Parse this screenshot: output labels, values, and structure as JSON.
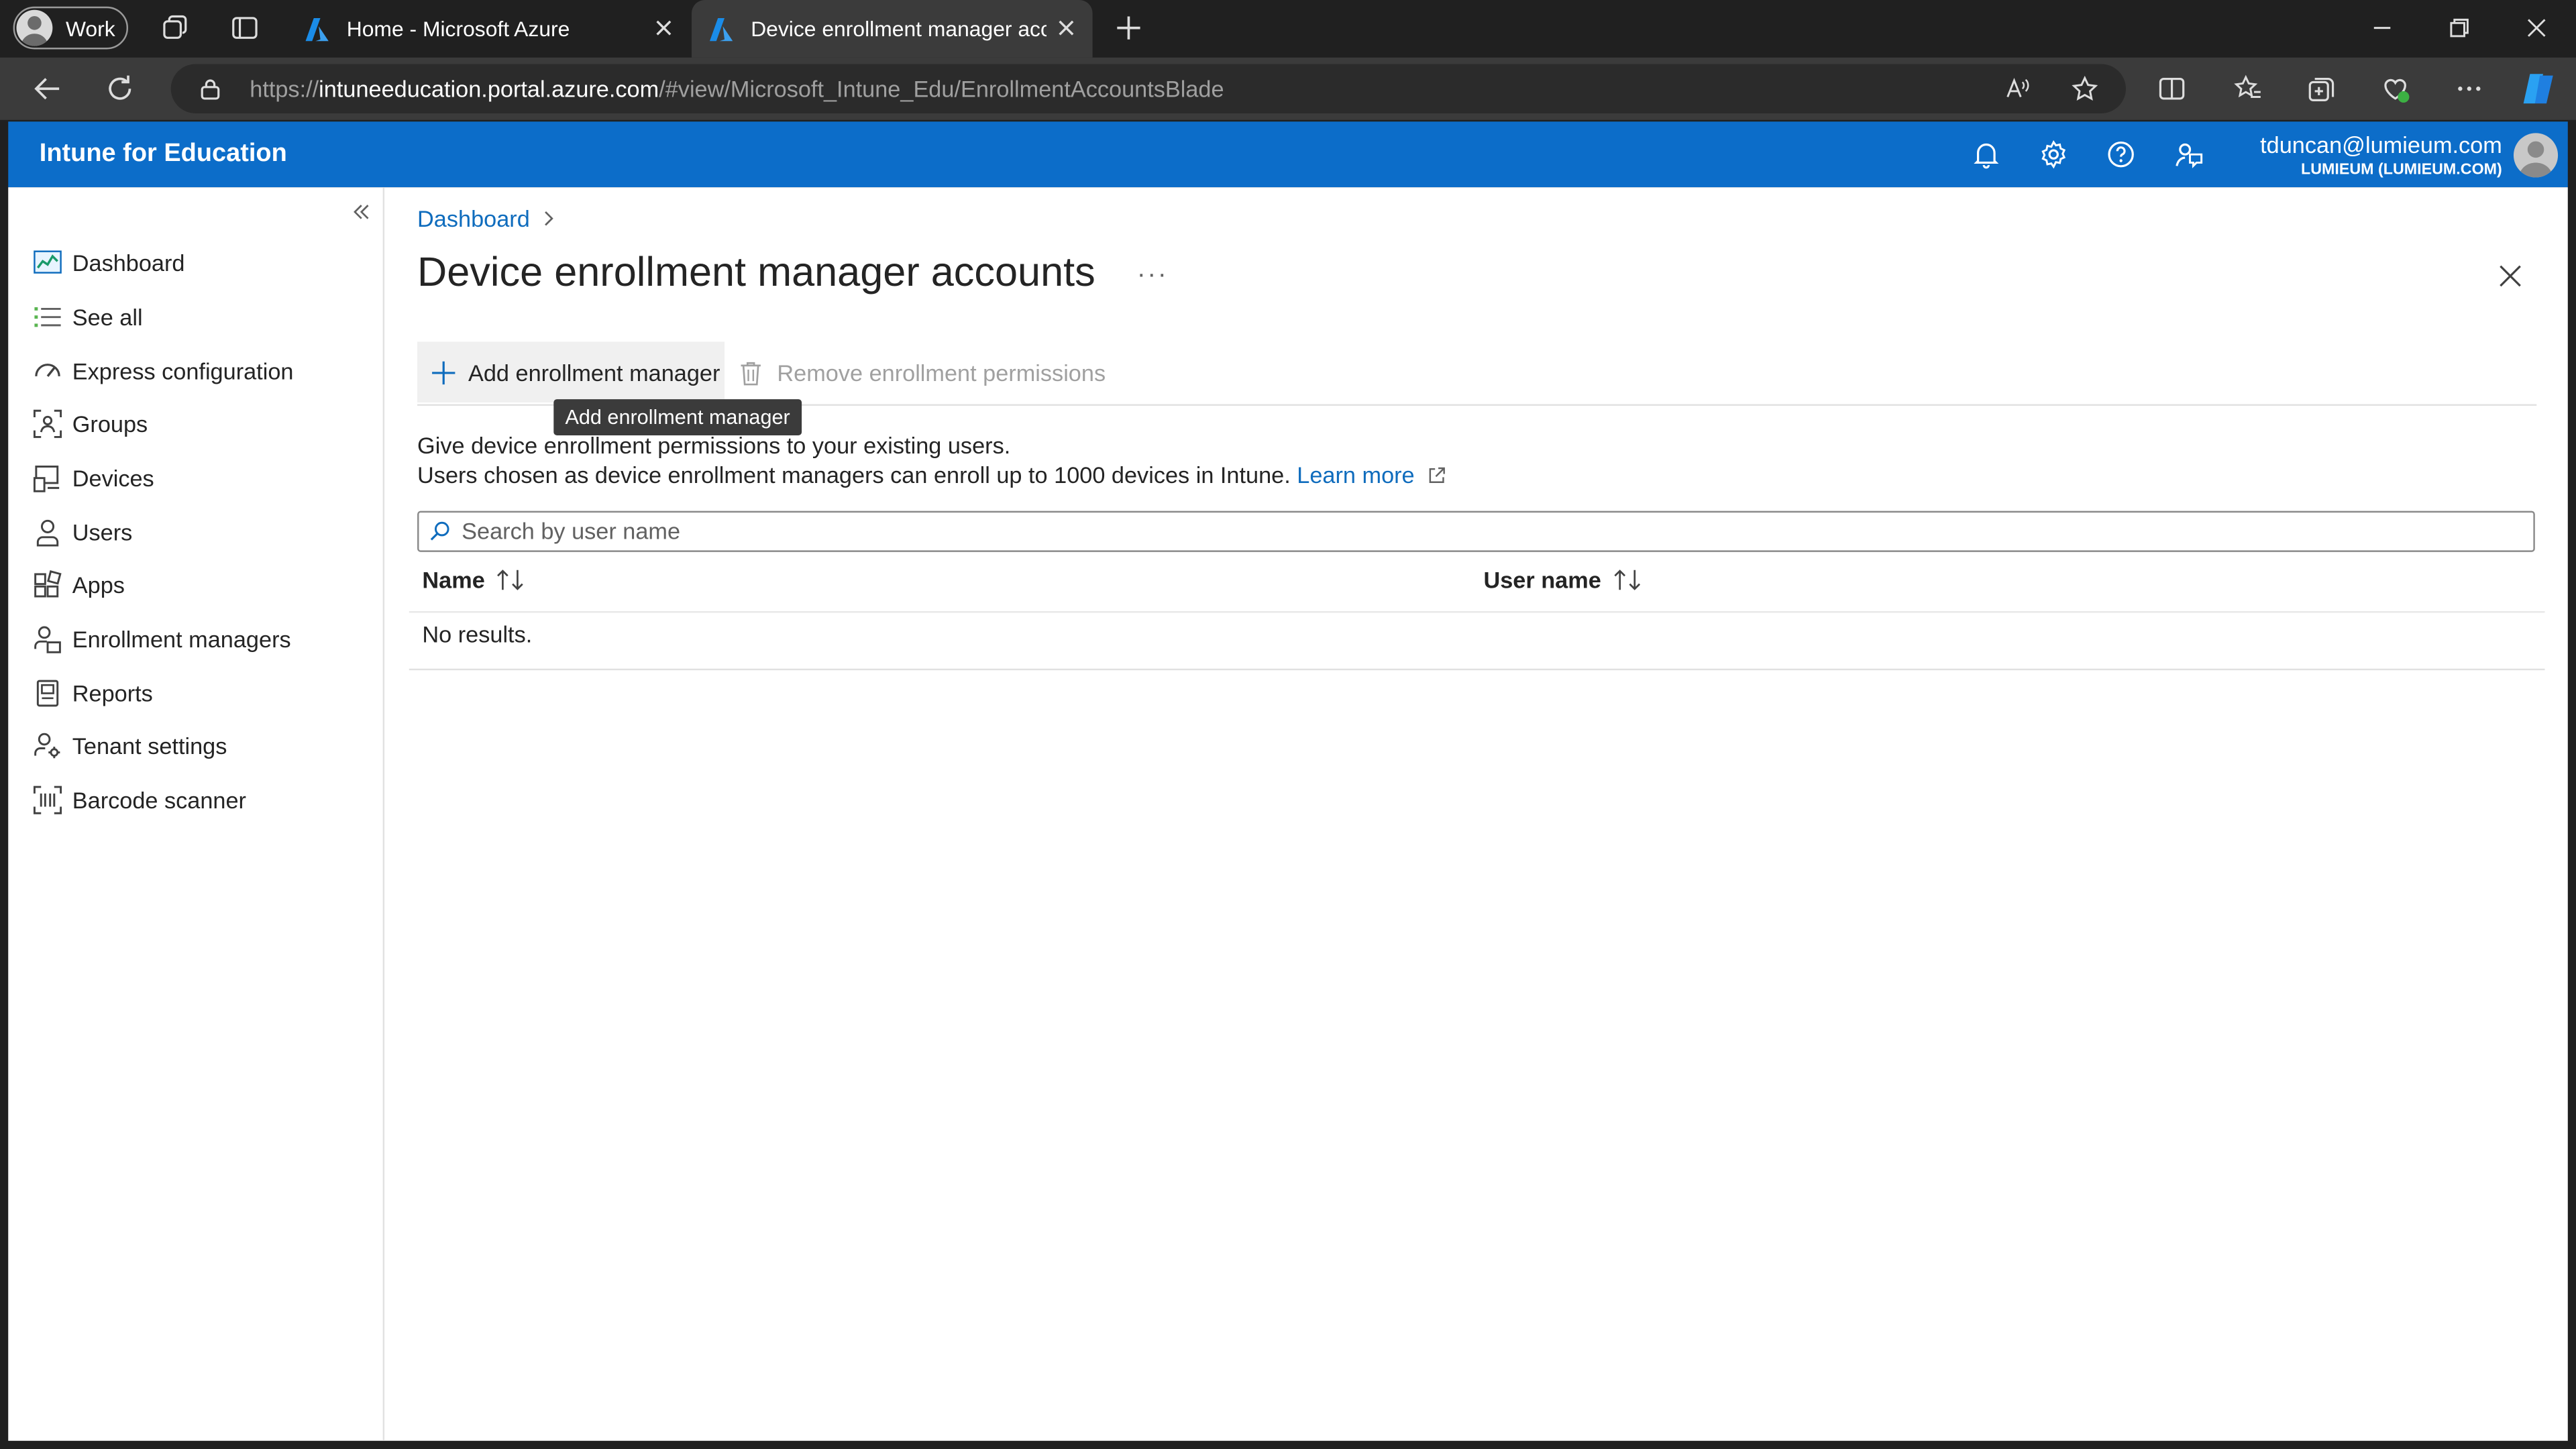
{
  "browser": {
    "profile_label": "Work",
    "tabs": [
      {
        "title": "Home - Microsoft Azure"
      },
      {
        "title": "Device enrollment manager accounts"
      }
    ],
    "url": {
      "scheme": "https://",
      "host": "intuneeducation.portal.azure.com",
      "path": "/#view/Microsoft_Intune_Edu/EnrollmentAccountsBlade"
    }
  },
  "app": {
    "title": "Intune for Education",
    "user_email": "tduncan@lumieum.com",
    "tenant": "LUMIEUM (LUMIEUM.COM)",
    "accent_color": "#0c6dc9"
  },
  "sidebar": {
    "items": [
      {
        "label": "Dashboard",
        "icon": "dashboard-icon"
      },
      {
        "label": "See all",
        "icon": "list-icon"
      },
      {
        "label": "Express configuration",
        "icon": "gauge-icon"
      },
      {
        "label": "Groups",
        "icon": "groups-icon"
      },
      {
        "label": "Devices",
        "icon": "devices-icon"
      },
      {
        "label": "Users",
        "icon": "user-icon"
      },
      {
        "label": "Apps",
        "icon": "apps-icon"
      },
      {
        "label": "Enrollment managers",
        "icon": "enrollment-managers-icon"
      },
      {
        "label": "Reports",
        "icon": "reports-icon"
      },
      {
        "label": "Tenant settings",
        "icon": "tenant-settings-icon"
      },
      {
        "label": "Barcode scanner",
        "icon": "barcode-icon"
      }
    ]
  },
  "page": {
    "breadcrumb": "Dashboard",
    "title": "Device enrollment manager accounts",
    "more_label": "···",
    "add_button": "Add enrollment manager",
    "remove_button": "Remove enrollment permissions",
    "tooltip": "Add enrollment manager",
    "desc_line1": "Give device enrollment permissions to your existing users.",
    "desc_line2": "Users chosen as device enrollment managers can enroll up to 1000 devices in Intune.",
    "learn_more": "Learn more",
    "search_placeholder": "Search by user name",
    "columns": [
      "Name",
      "User name"
    ],
    "empty_message": "No results."
  }
}
